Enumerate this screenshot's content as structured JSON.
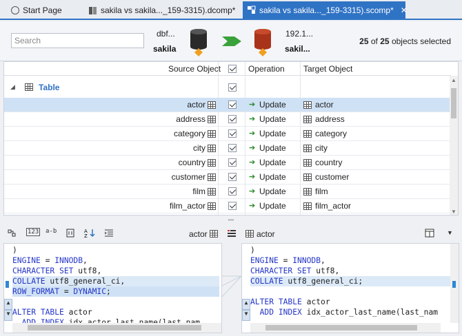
{
  "tabs": [
    {
      "label": "Start Page",
      "active": false
    },
    {
      "label": "sakila vs sakila..._159-3315).dcomp*",
      "active": false
    },
    {
      "label": "sakila vs sakila..._159-3315).scomp*",
      "active": true
    }
  ],
  "header": {
    "search_placeholder": "Search",
    "source": {
      "server": "dbf...",
      "db": "sakila"
    },
    "target": {
      "server": "192.1...",
      "db": "sakil..."
    },
    "selected": {
      "count": "25",
      "total": "25",
      "suffix": "objects selected",
      "of": "of"
    }
  },
  "grid": {
    "columns": {
      "source": "Source Object",
      "operation": "Operation",
      "target": "Target Object"
    },
    "group_label": "Table",
    "rows": [
      {
        "source": "actor",
        "operation": "Update",
        "target": "actor",
        "selected": true
      },
      {
        "source": "address",
        "operation": "Update",
        "target": "address",
        "selected": false
      },
      {
        "source": "category",
        "operation": "Update",
        "target": "category",
        "selected": false
      },
      {
        "source": "city",
        "operation": "Update",
        "target": "city",
        "selected": false
      },
      {
        "source": "country",
        "operation": "Update",
        "target": "country",
        "selected": false
      },
      {
        "source": "customer",
        "operation": "Update",
        "target": "customer",
        "selected": false
      },
      {
        "source": "film",
        "operation": "Update",
        "target": "film",
        "selected": false
      },
      {
        "source": "film_actor",
        "operation": "Update",
        "target": "film_actor",
        "selected": false
      }
    ]
  },
  "toolbar": {
    "icons": [
      "123",
      "a-b"
    ],
    "left_object": "actor",
    "right_object": "actor"
  },
  "code_left": [
    ")",
    "ENGINE = INNODB,",
    "CHARACTER SET utf8,",
    "COLLATE utf8_general_ci,",
    "ROW_FORMAT = DYNAMIC;",
    "",
    "ALTER TABLE actor",
    "  ADD INDEX idx_actor_last_name(last_nam"
  ],
  "code_right": [
    ")",
    "ENGINE = INNODB,",
    "CHARACTER SET utf8,",
    "COLLATE utf8_general_ci;",
    "",
    "ALTER TABLE actor",
    "  ADD INDEX idx_actor_last_name(last_nam"
  ],
  "colors": {
    "accent": "#2f73c5",
    "selection": "#cfe1f5",
    "keyword": "#2435c7",
    "update_arrow": "#2a8a2a"
  }
}
